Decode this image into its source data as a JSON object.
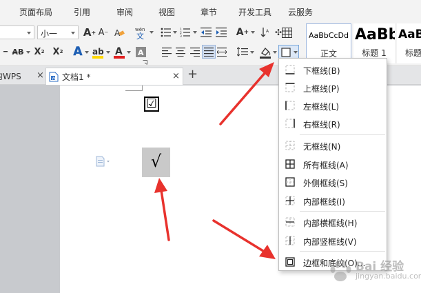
{
  "menubar": {
    "tabs": [
      "页面布局",
      "引用",
      "审阅",
      "视图",
      "章节",
      "开发工具",
      "云服务"
    ]
  },
  "ribbon": {
    "font_size": "小一",
    "styles": [
      {
        "preview": "AaBbCcDd",
        "label": "正文"
      },
      {
        "preview": "AaBb",
        "label": "标题 1"
      },
      {
        "preview": "AaBb",
        "label": "标题"
      }
    ]
  },
  "tabs": {
    "inactive": "的WPS",
    "active": "文档1 *",
    "close": "×",
    "add": "+"
  },
  "document": {
    "checkbox_char": "☑",
    "check_char": "√"
  },
  "border_menu": {
    "items": [
      {
        "label": "下框线(B)",
        "icon": "bottom-border-icon"
      },
      {
        "label": "上框线(P)",
        "icon": "top-border-icon"
      },
      {
        "label": "左框线(L)",
        "icon": "left-border-icon"
      },
      {
        "label": "右框线(R)",
        "icon": "right-border-icon"
      },
      {
        "label": "无框线(N)",
        "icon": "no-border-icon"
      },
      {
        "label": "所有框线(A)",
        "icon": "all-borders-icon"
      },
      {
        "label": "外侧框线(S)",
        "icon": "outside-borders-icon"
      },
      {
        "label": "内部框线(I)",
        "icon": "inside-borders-icon"
      },
      {
        "label": "内部横框线(H)",
        "icon": "inside-horizontal-border-icon"
      },
      {
        "label": "内部竖框线(V)",
        "icon": "inside-vertical-border-icon"
      },
      {
        "label": "边框和底纹(O)...",
        "icon": "borders-and-shading-icon"
      }
    ]
  },
  "watermark": {
    "text": "Bai 经验",
    "url": "jingyan.baidu.com"
  },
  "colors": {
    "arrow": "#e8322d",
    "highlight_yellow": "#ffd800",
    "font_red": "#e02020",
    "ribbon_bg": "#f3f3f3"
  }
}
